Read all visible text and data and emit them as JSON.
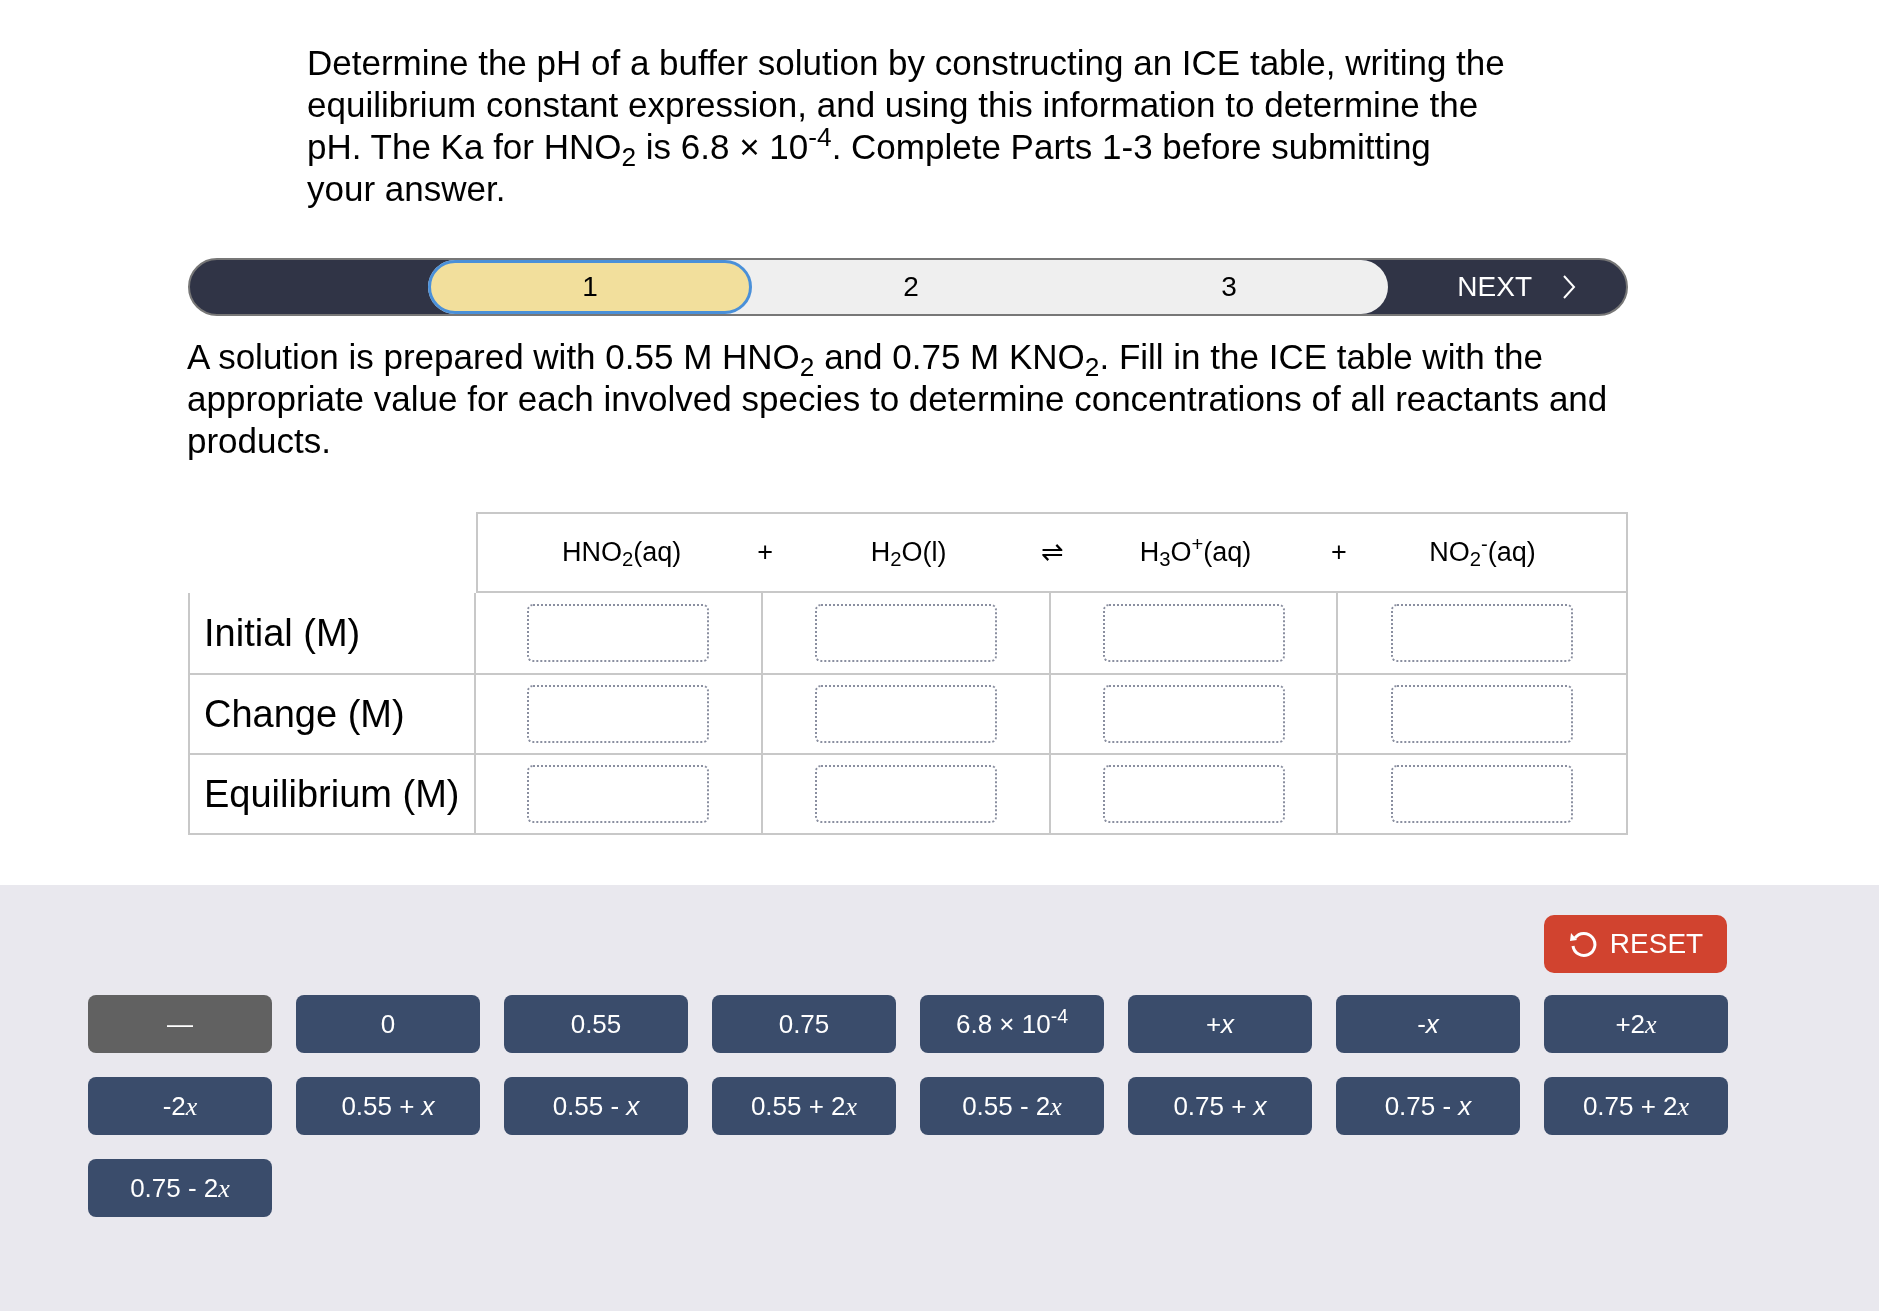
{
  "intro": "Determine the pH of a buffer solution by constructing an ICE table, writing the equilibrium constant expression, and using this information to determine the pH. The Ka for HNO$_{2}$ is 6.8 × 10$^{-4}$. Complete Parts 1-3 before submitting your answer.",
  "steps": [
    {
      "label": "1",
      "selected": true
    },
    {
      "label": "2",
      "selected": false
    },
    {
      "label": "3",
      "selected": false
    }
  ],
  "next": {
    "label": "NEXT"
  },
  "question": "A solution is prepared with 0.55 M HNO$_{2}$ and 0.75 M KNO$_{2}$. Fill in the ICE table with the appropriate value for each involved species to determine concentrations of all reactants and products.",
  "equation": [
    {
      "kind": "species",
      "text": "HNO$_{2}$(aq)"
    },
    {
      "kind": "operator",
      "text": "+"
    },
    {
      "kind": "species",
      "text": "H$_{2}$O(l)"
    },
    {
      "kind": "operator",
      "text": "⇌"
    },
    {
      "kind": "species",
      "text": "H$_{3}$O$^{+}$(aq)"
    },
    {
      "kind": "operator",
      "text": "+"
    },
    {
      "kind": "species",
      "text": "NO$_{2}$$^{-}$(aq)"
    }
  ],
  "rows": [
    {
      "label": "Initial (M)"
    },
    {
      "label": "Change (M)"
    },
    {
      "label": "Equilibrium (M)"
    }
  ],
  "reset": {
    "label": "RESET"
  },
  "tiles": [
    {
      "text": "—",
      "disabled": true
    },
    {
      "text": "0",
      "disabled": false
    },
    {
      "text": "0.55",
      "disabled": false
    },
    {
      "text": "0.75",
      "disabled": false
    },
    {
      "text": "6.8 × 10$^{-4}$",
      "disabled": false
    },
    {
      "text": "+*x*",
      "disabled": false
    },
    {
      "text": "-*x*",
      "disabled": false
    },
    {
      "text": "+2",
      "variable": "x",
      "disabled": false
    },
    {
      "text": "-2",
      "variable": "x",
      "disabled": false
    },
    {
      "text": "0.55 + *x*",
      "disabled": false
    },
    {
      "text": "0.55 - *x*",
      "disabled": false
    },
    {
      "text": "0.55 + 2",
      "variable": "x",
      "disabled": false
    },
    {
      "text": "0.55 - 2",
      "variable": "x",
      "disabled": false
    },
    {
      "text": "0.75 + *x*",
      "disabled": false
    },
    {
      "text": "0.75 - *x*",
      "disabled": false
    },
    {
      "text": "0.75 + 2",
      "variable": "x",
      "disabled": false
    },
    {
      "text": "0.75 - 2",
      "variable": "x",
      "disabled": false
    }
  ]
}
